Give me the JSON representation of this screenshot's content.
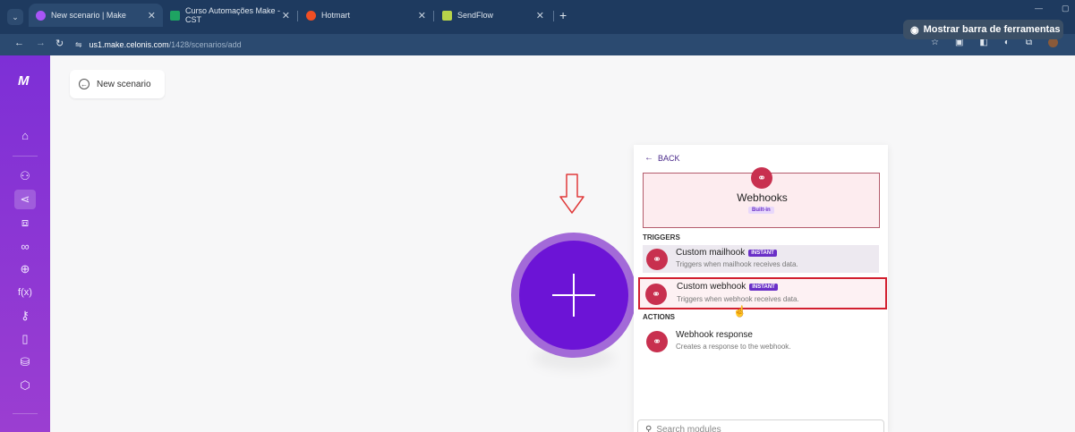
{
  "browser": {
    "tabs": [
      {
        "title": "New scenario | Make",
        "icon": "make-favicon",
        "color": "#a855f7"
      },
      {
        "title": "Curso Automações Make - CST",
        "icon": "sheets-favicon",
        "color": "#1ea362"
      },
      {
        "title": "Hotmart",
        "icon": "hotmart-favicon",
        "color": "#f04e23"
      },
      {
        "title": "SendFlow",
        "icon": "sendflow-favicon",
        "color": "#b8d44a"
      }
    ],
    "url_host": "us1.make.celonis.com",
    "url_path": "/1428/scenarios/add",
    "overlay_button": "Mostrar barra de ferramentas"
  },
  "sidebar": {
    "logo": "M",
    "icons": [
      "home-icon",
      "team-icon",
      "scenarios-icon",
      "templates-icon",
      "connections-icon",
      "webhooks-icon",
      "functions-icon",
      "keys-icon",
      "devices-icon",
      "datastores-icon",
      "datastructures-icon"
    ]
  },
  "scenario": {
    "title": "New scenario"
  },
  "panel": {
    "back_label": "BACK",
    "app": {
      "name": "Webhooks",
      "badge": "Built-in"
    },
    "triggers_title": "TRIGGERS",
    "triggers": [
      {
        "name": "Custom mailhook",
        "badge": "INSTANT",
        "desc": "Triggers when mailhook receives data."
      },
      {
        "name": "Custom webhook",
        "badge": "INSTANT",
        "desc": "Triggers when webhook receives data."
      }
    ],
    "actions_title": "ACTIONS",
    "actions": [
      {
        "name": "Webhook response",
        "desc": "Creates a response to the webhook."
      }
    ],
    "search_placeholder": "Search modules"
  },
  "colors": {
    "sidebar": "#8a35d4",
    "module": "#6c14d6",
    "webhook": "#c8304f",
    "highlight": "#d21f2f"
  }
}
